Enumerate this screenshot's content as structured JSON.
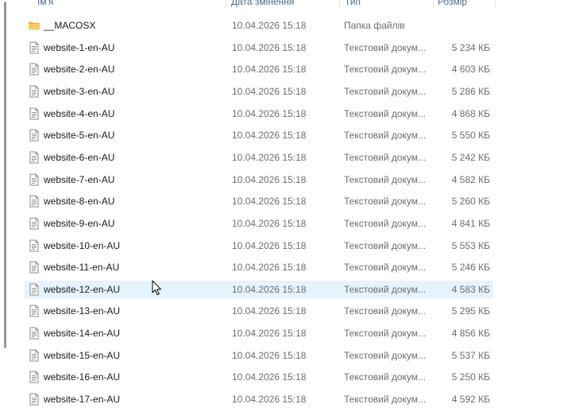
{
  "columns": {
    "name": "Ім'я",
    "date": "Дата змінення",
    "type": "Тип",
    "size": "Розмір"
  },
  "files": [
    {
      "name": "__MACOSX",
      "date": "10.04.2026 15:18",
      "type": "Папка файлів",
      "size": "",
      "icon": "folder-icon"
    },
    {
      "name": "website-1-en-AU",
      "date": "10.04.2026 15:18",
      "type": "Текстовий докум...",
      "size": "5 234 КБ",
      "icon": "text-file-icon"
    },
    {
      "name": "website-2-en-AU",
      "date": "10.04.2026 15:18",
      "type": "Текстовий докум...",
      "size": "4 603 КБ",
      "icon": "text-file-icon"
    },
    {
      "name": "website-3-en-AU",
      "date": "10.04.2026 15:18",
      "type": "Текстовий докум...",
      "size": "5 286 КБ",
      "icon": "text-file-icon"
    },
    {
      "name": "website-4-en-AU",
      "date": "10.04.2026 15:18",
      "type": "Текстовий докум...",
      "size": "4 868 КБ",
      "icon": "text-file-icon"
    },
    {
      "name": "website-5-en-AU",
      "date": "10.04.2026 15:18",
      "type": "Текстовий докум...",
      "size": "5 550 КБ",
      "icon": "text-file-icon"
    },
    {
      "name": "website-6-en-AU",
      "date": "10.04.2026 15:18",
      "type": "Текстовий докум...",
      "size": "5 242 КБ",
      "icon": "text-file-icon"
    },
    {
      "name": "website-7-en-AU",
      "date": "10.04.2026 15:18",
      "type": "Текстовий докум...",
      "size": "4 582 КБ",
      "icon": "text-file-icon"
    },
    {
      "name": "website-8-en-AU",
      "date": "10.04.2026 15:18",
      "type": "Текстовий докум...",
      "size": "5 260 КБ",
      "icon": "text-file-icon"
    },
    {
      "name": "website-9-en-AU",
      "date": "10.04.2026 15:18",
      "type": "Текстовий докум...",
      "size": "4 841 КБ",
      "icon": "text-file-icon"
    },
    {
      "name": "website-10-en-AU",
      "date": "10.04.2026 15:18",
      "type": "Текстовий докум...",
      "size": "5 553 КБ",
      "icon": "text-file-icon"
    },
    {
      "name": "website-11-en-AU",
      "date": "10.04.2026 15:18",
      "type": "Текстовий докум...",
      "size": "5 246 КБ",
      "icon": "text-file-icon"
    },
    {
      "name": "website-12-en-AU",
      "date": "10.04.2026 15:18",
      "type": "Текстовий докум...",
      "size": "4 583 КБ",
      "icon": "text-file-icon",
      "hovered": true
    },
    {
      "name": "website-13-en-AU",
      "date": "10.04.2026 15:18",
      "type": "Текстовий докум...",
      "size": "5 295 КБ",
      "icon": "text-file-icon"
    },
    {
      "name": "website-14-en-AU",
      "date": "10.04.2026 15:18",
      "type": "Текстовий докум...",
      "size": "4 856 КБ",
      "icon": "text-file-icon"
    },
    {
      "name": "website-15-en-AU",
      "date": "10.04.2026 15:18",
      "type": "Текстовий докум...",
      "size": "5 537 КБ",
      "icon": "text-file-icon"
    },
    {
      "name": "website-16-en-AU",
      "date": "10.04.2026 15:18",
      "type": "Текстовий докум...",
      "size": "5 250 КБ",
      "icon": "text-file-icon"
    },
    {
      "name": "website-17-en-AU",
      "date": "10.04.2026 15:18",
      "type": "Текстовий докум...",
      "size": "4 592 КБ",
      "icon": "text-file-icon"
    }
  ],
  "colors": {
    "hover_row": "#e5f3ff",
    "folder": "#f3c85f",
    "header_text": "#4d6a8a"
  }
}
